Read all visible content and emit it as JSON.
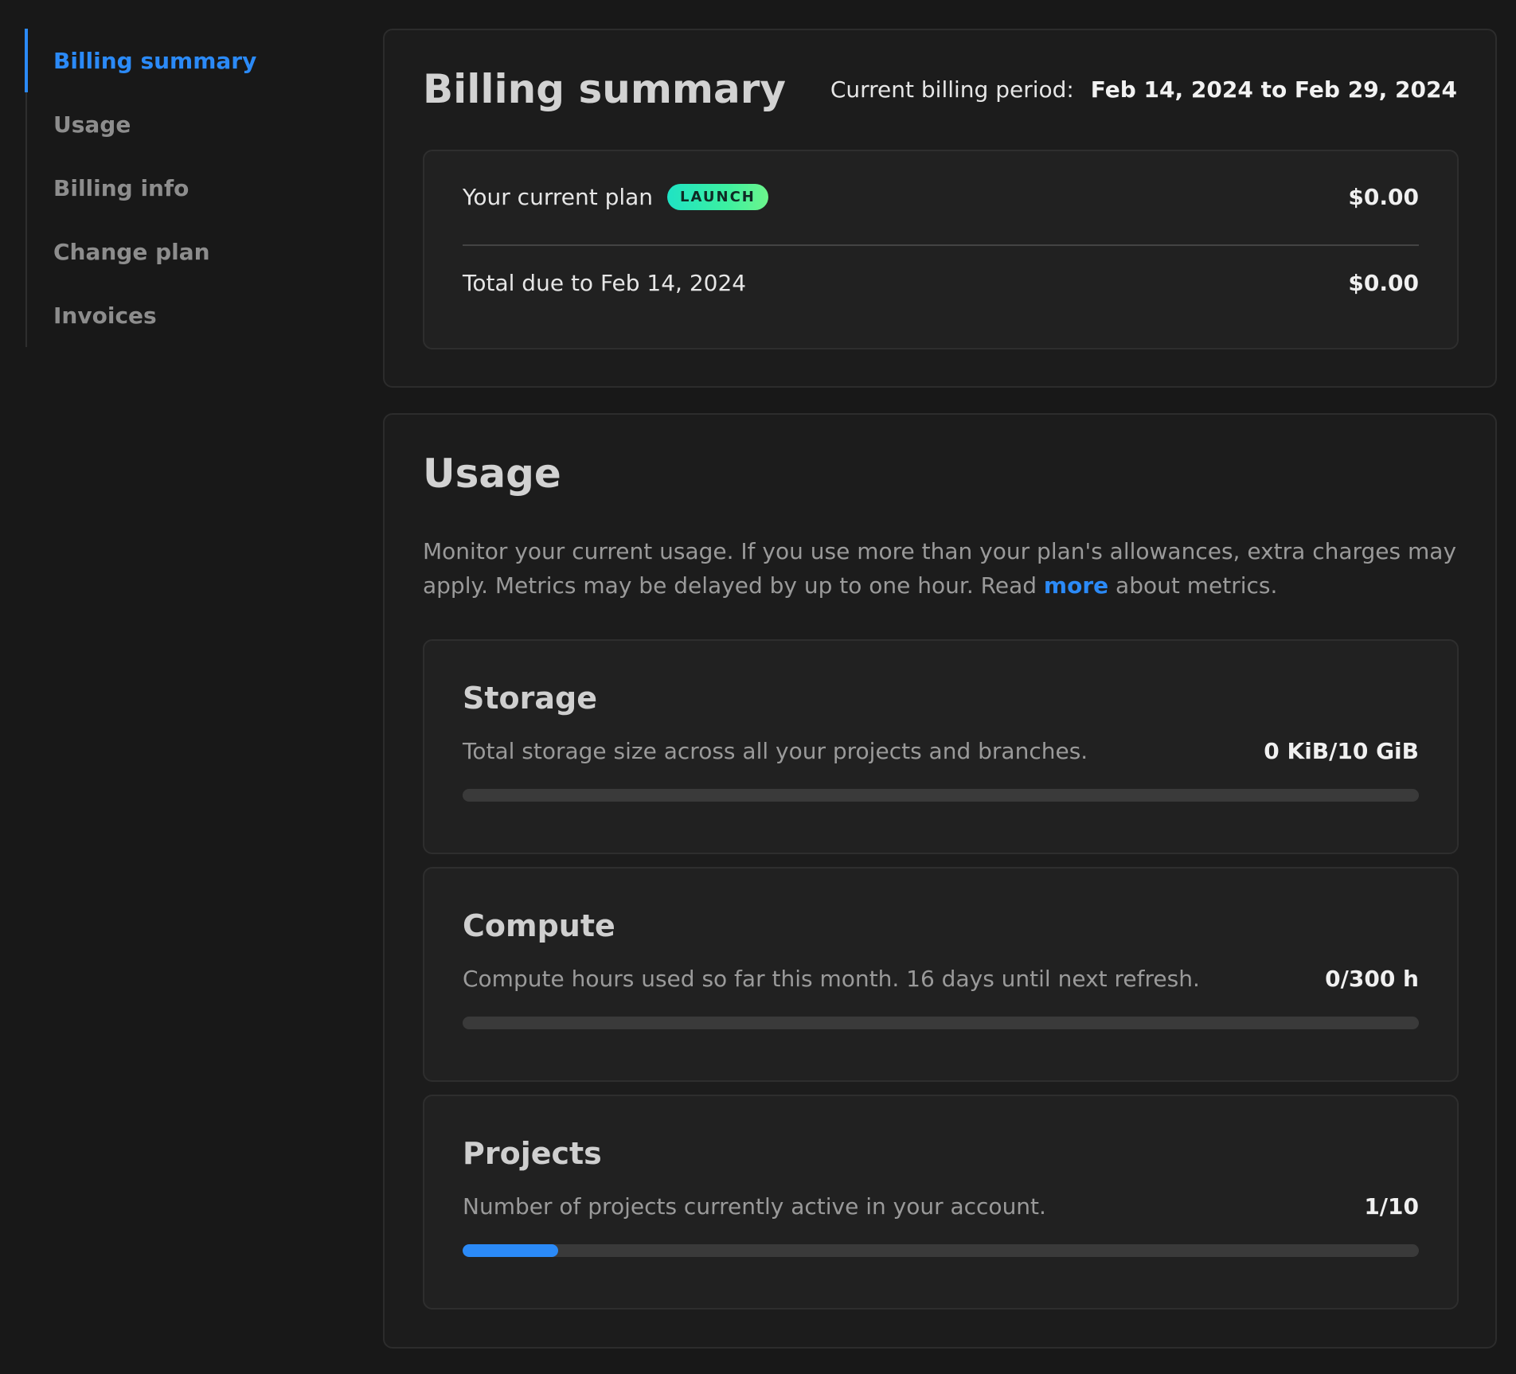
{
  "sidebar": {
    "items": [
      {
        "label": "Billing summary",
        "active": true
      },
      {
        "label": "Usage",
        "active": false
      },
      {
        "label": "Billing info",
        "active": false
      },
      {
        "label": "Change plan",
        "active": false
      },
      {
        "label": "Invoices",
        "active": false
      }
    ]
  },
  "billing": {
    "title": "Billing summary",
    "period_label": "Current billing period:",
    "period_value": "Feb 14, 2024 to Feb 29, 2024",
    "plan_label": "Your current plan",
    "plan_badge": "LAUNCH",
    "plan_amount": "$0.00",
    "due_label": "Total due to Feb 14, 2024",
    "due_amount": "$0.00"
  },
  "usage": {
    "title": "Usage",
    "desc_before": "Monitor your current usage. If you use more than your plan's allowances, extra charges may apply. Metrics may be delayed by up to one hour. Read ",
    "desc_link": "more",
    "desc_after": " about metrics.",
    "metrics": [
      {
        "id": "storage",
        "title": "Storage",
        "desc": "Total storage size across all your projects and branches.",
        "value": "0 KiB/10 GiB",
        "progress": 0.0
      },
      {
        "id": "compute",
        "title": "Compute",
        "desc": "Compute hours used so far this month. 16 days until next refresh.",
        "value": "0/300 h",
        "progress": 0.0
      },
      {
        "id": "projects",
        "title": "Projects",
        "desc": "Number of projects currently active in your account.",
        "value": "1/10",
        "progress": 0.1
      }
    ]
  },
  "colors": {
    "accent": "#2b8af7",
    "background": "#181818",
    "card": "#1c1c1c",
    "badge_start": "#1fe3c4",
    "badge_end": "#6df58c"
  }
}
